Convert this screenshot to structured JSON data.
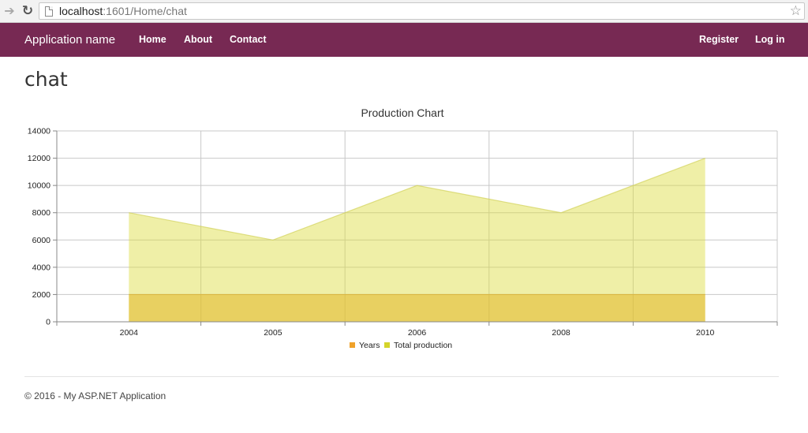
{
  "browser": {
    "url_host": "localhost",
    "url_path": ":1601/Home/chat"
  },
  "navbar": {
    "brand": "Application name",
    "links": [
      "Home",
      "About",
      "Contact"
    ],
    "right_links": [
      "Register",
      "Log in"
    ],
    "background_color": "#772953"
  },
  "page": {
    "title": "chat"
  },
  "chart_data": {
    "type": "area",
    "title": "Production Chart",
    "xlabel": "",
    "ylabel": "",
    "categories": [
      "2004",
      "2005",
      "2006",
      "2008",
      "2010"
    ],
    "series": [
      {
        "name": "Years",
        "values": [
          2000,
          2000,
          2000,
          2000,
          2000
        ],
        "color": "#f0a22a"
      },
      {
        "name": "Total production",
        "values": [
          8000,
          6000,
          10000,
          8000,
          12000
        ],
        "color": "#d4d42a"
      }
    ],
    "ylim": [
      0,
      14000
    ],
    "yticks": [
      0,
      2000,
      4000,
      6000,
      8000,
      10000,
      12000,
      14000
    ],
    "grid": true,
    "legend": "bottom"
  },
  "footer": {
    "text": "© 2016 - My ASP.NET Application"
  }
}
